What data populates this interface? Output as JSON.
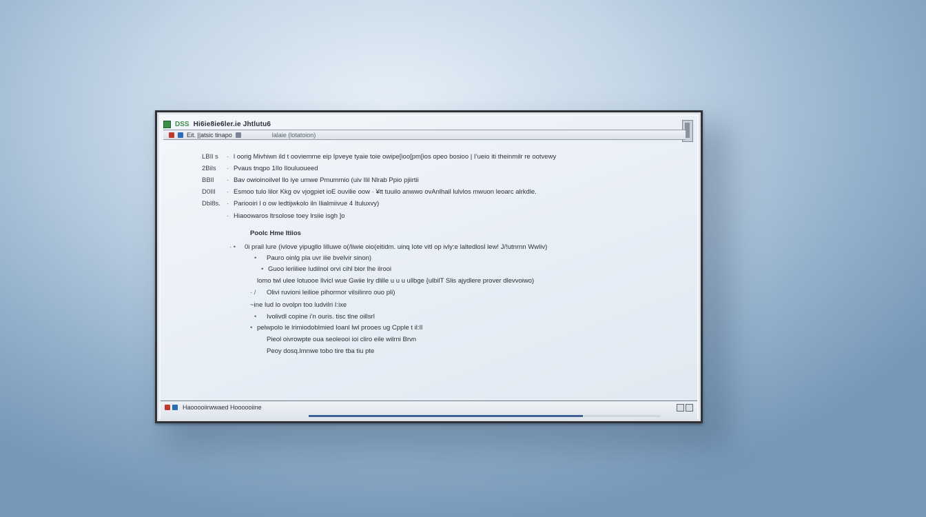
{
  "window": {
    "app_abbr": "DSS",
    "title": "Hi6ie8ie6ler.ie Jhtlutu6"
  },
  "toolbar": {
    "label": "Eit. ||atsic tinapo",
    "sub_label": "lalaie (lotatoion)"
  },
  "lines": [
    {
      "label": "LBIl s",
      "bullet": "·",
      "text": "l oorig Mivhiwn ild t ooviemme eip Ipveye tyaie toie owipe[ioo[pm[ios opeo bosioo | I’ueio iti theinmilr re ootvewy"
    },
    {
      "label": "2Bils",
      "bullet": "·",
      "text": "Pvaus tnqpo 1Ilo Ilouluoueed"
    },
    {
      "label": "BBIl",
      "bullet": "·",
      "text": "Bav owioinoilvel llo iye umwe Pmummio (uiv Ilil Nlrab Ppio pjiirtii"
    },
    {
      "label": "D0IIl",
      "bullet": "·",
      "text": "Esmoo tulo lilor Kkg ov vjogpiet ioE ouvilie oow · ¥tt tuuilo anwwo ovAnlhail lulvlos mwuon leoarc alrkdle."
    },
    {
      "label": "Dbl8s.",
      "bullet": "·",
      "text": "Pariooiri l o ow ledtijwkolo iln Ilialmiivue 4 Ituluxvy)"
    },
    {
      "label": "",
      "bullet": "·",
      "text": "Hiaoowaros ltrsolose toey lrsiie isgh ]o"
    },
    {
      "label": "",
      "bullet": "",
      "text": "Poolc Hme Itiios",
      "heading": true
    },
    {
      "label": "",
      "bullet": "· •",
      "text": "0i prail lure (ivlove yipugllo Iilluwe o(/liwie oio(eitidm. uinq Iote vitl op ivly:e laltedlosl lew! J/!utnrnn Wwliv)"
    },
    {
      "label": "",
      "bullet": "•",
      "text": "Pauro oinlg pla uvr ilie bvelvir sinon)"
    },
    {
      "label": "",
      "bullet": "•",
      "text": "Guoo leriiliee ludilnol orvi cihl bior lhe ilrooi"
    },
    {
      "label": "",
      "bullet": "",
      "text": "lomo twl ulee lotuooe Ilvicl wue Gwiie lry dlille u u u ullbge {ulbilT Slis ajydlere prover dlevvoiwo)"
    },
    {
      "label": "",
      "bullet": "· /",
      "text": "Olivi ruvioni leilioe pihormor vilsilinro ouo pli)"
    },
    {
      "label": "",
      "bullet": "",
      "text": "~ine Iud lo ovolpn too ludvilri I:ixe"
    },
    {
      "label": "",
      "bullet": "•",
      "text": "Ivolivdl copine i’n ouris. tisc tlne oillsrl"
    },
    {
      "label": "",
      "bullet": "•",
      "text": "pelwpolo le lrimiodoblmied Ioanl lwl prooes ug Cpple t il:Il"
    },
    {
      "label": "",
      "bullet": "",
      "text": "Pieol oivrowpte oua seoleooi ioi cliro eile wilrni Brvn"
    },
    {
      "label": "",
      "bullet": "",
      "text": "Peoy dosq.lmnwe tobo tire tba tiu pte"
    }
  ],
  "statusbar": {
    "text": "Haooooiirwwaed Hoooooiine",
    "progress": 0.78
  },
  "colors": {
    "accent_green": "#3b8f4a",
    "progress_blue": "#3d5f93"
  }
}
